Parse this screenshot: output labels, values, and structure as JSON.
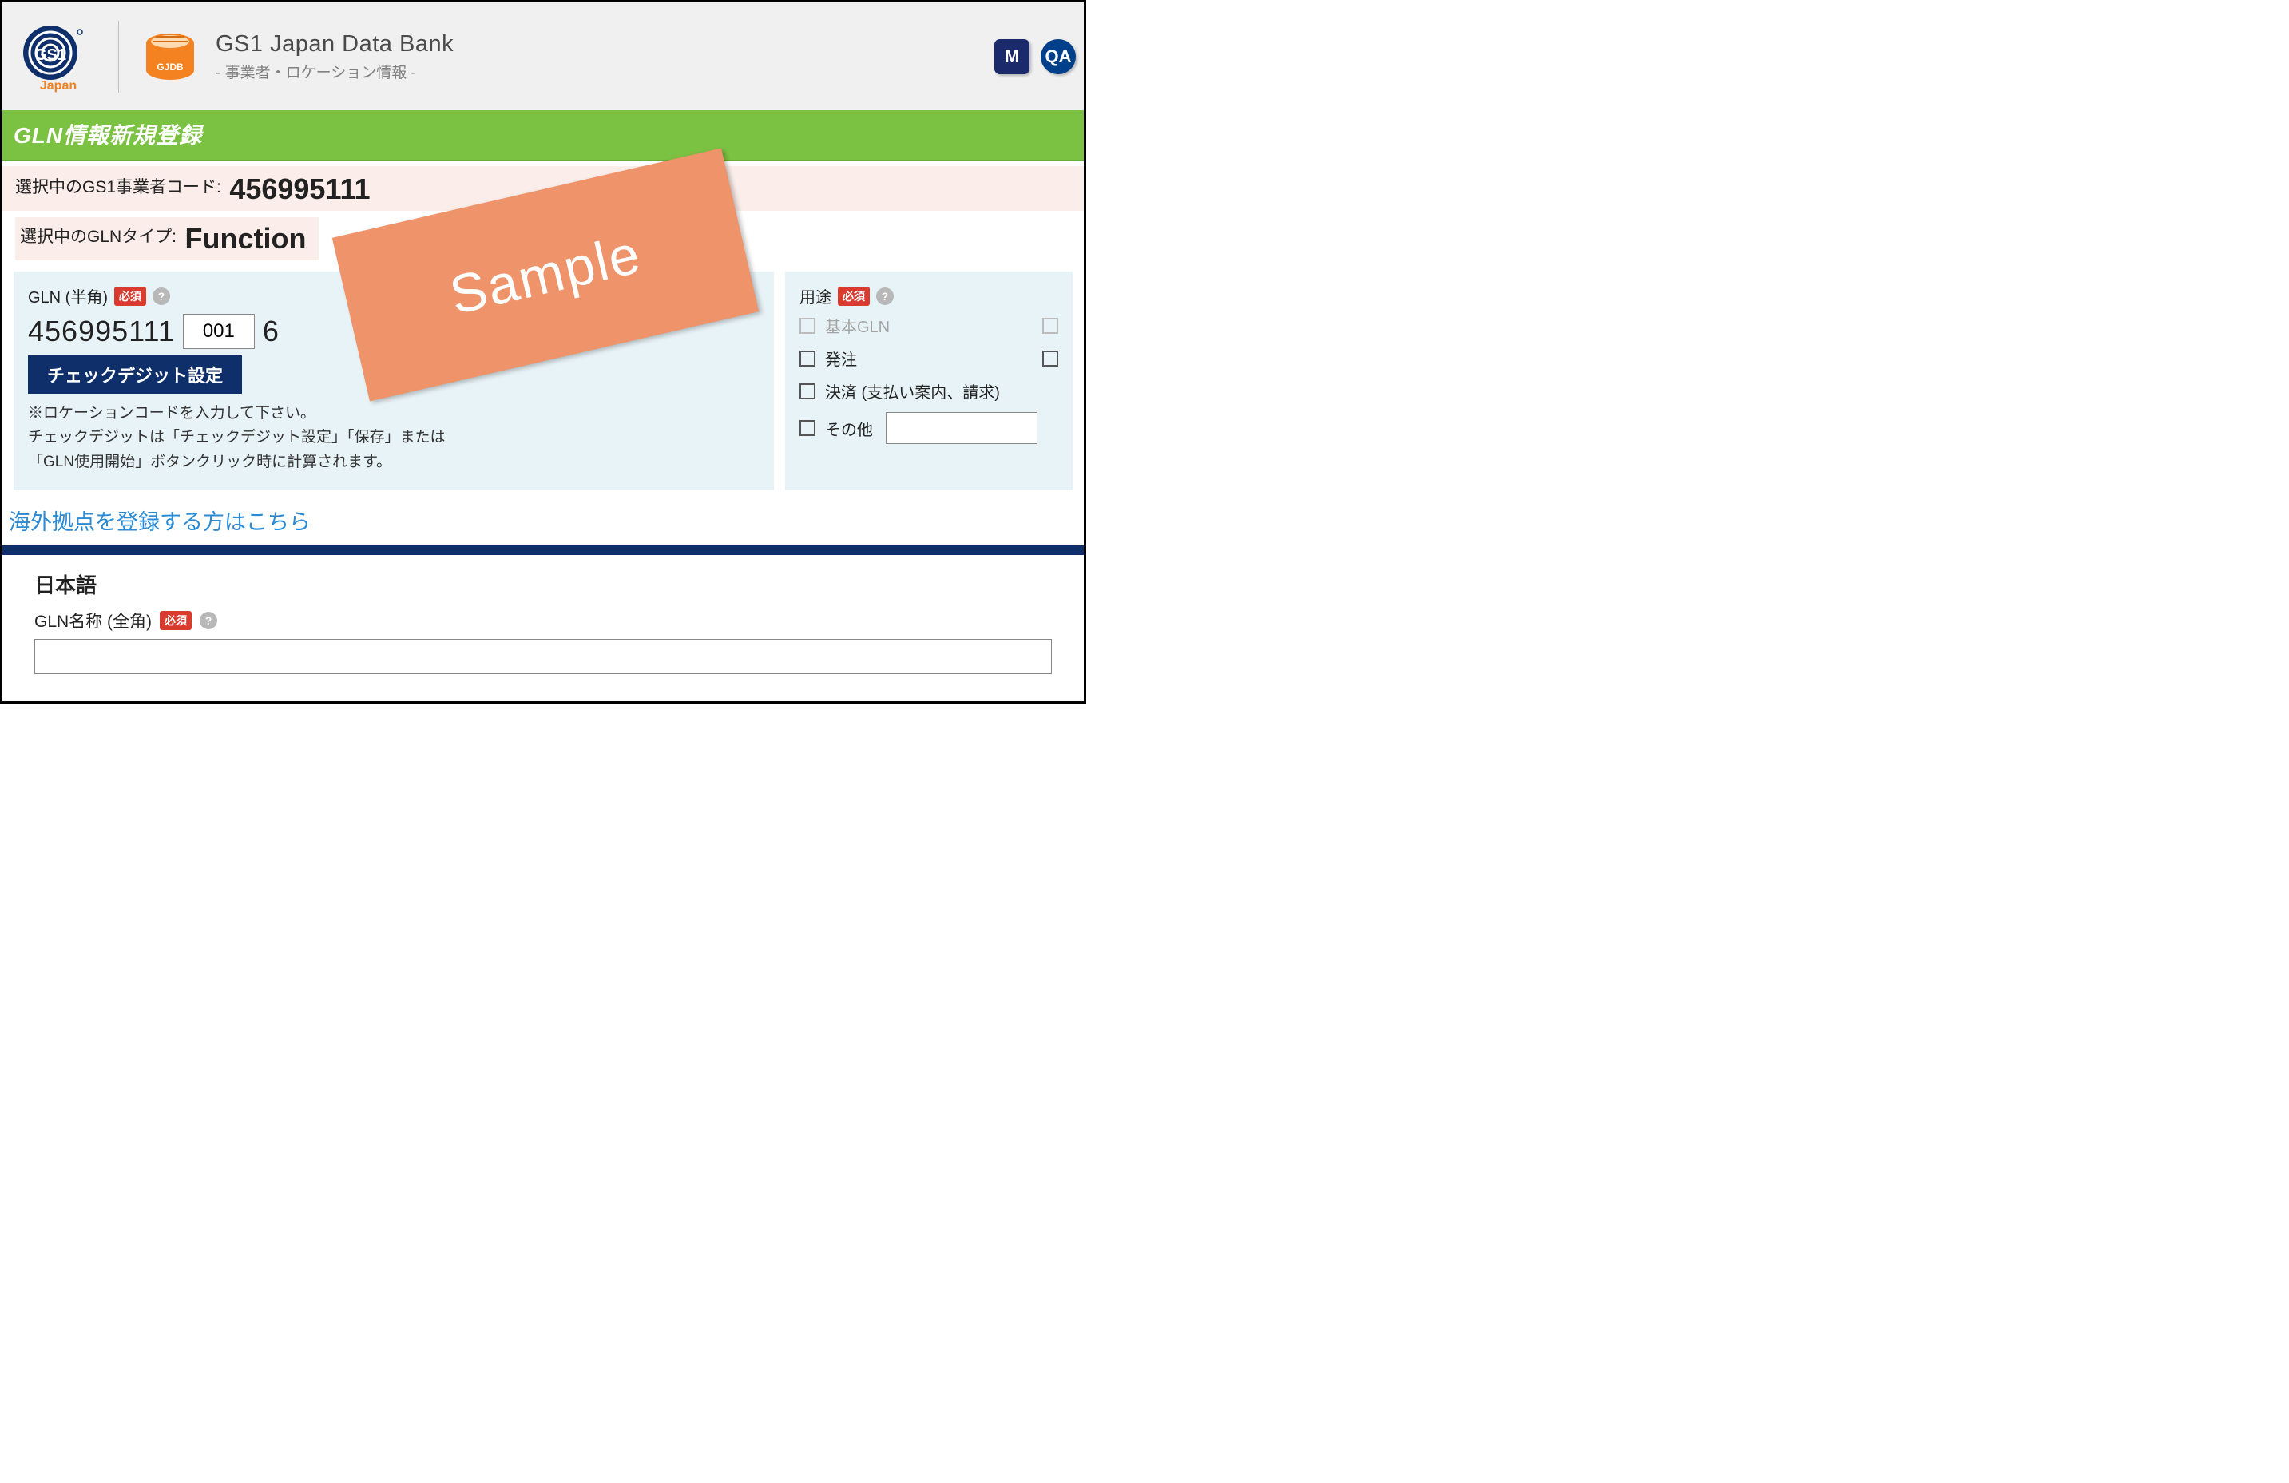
{
  "header": {
    "app_title": "GS1 Japan Data Bank",
    "app_subtitle": "- 事業者・ロケーション情報 -",
    "icon_m": "M",
    "icon_qa": "QA"
  },
  "titlebar": {
    "text": "GLN情報新規登録"
  },
  "selected": {
    "code_label": "選択中のGS1事業者コード:",
    "code_value": "456995111",
    "type_label": "選択中のGLNタイプ:",
    "type_value": "Function"
  },
  "gln": {
    "label": "GLN (半角)",
    "required": "必須",
    "prefix": "456995111",
    "location_value": "001",
    "check_digit": "6",
    "cd_button": "チェックデジット設定",
    "hint1": "※ロケーションコードを入力して下さい。",
    "hint2": "チェックデジットは「チェックデジット設定」「保存」または",
    "hint3": "「GLN使用開始」ボタンクリック時に計算されます。"
  },
  "usage": {
    "label": "用途",
    "required": "必須",
    "items": {
      "basic": "基本GLN",
      "order": "発注",
      "payment": "決済 (支払い案内、請求)",
      "other": "その他"
    }
  },
  "overseas_link": "海外拠点を登録する方はこちら",
  "jp": {
    "heading": "日本語",
    "gln_name_label": "GLN名称 (全角)",
    "required": "必須"
  },
  "watermark": "Sample",
  "colors": {
    "accent_green": "#7cc242",
    "accent_orange": "#f58220",
    "gs1_navy": "#0f2f6b",
    "sample_bg": "#ee936a",
    "req_red": "#d93c2f",
    "link": "#2a8ad4"
  }
}
